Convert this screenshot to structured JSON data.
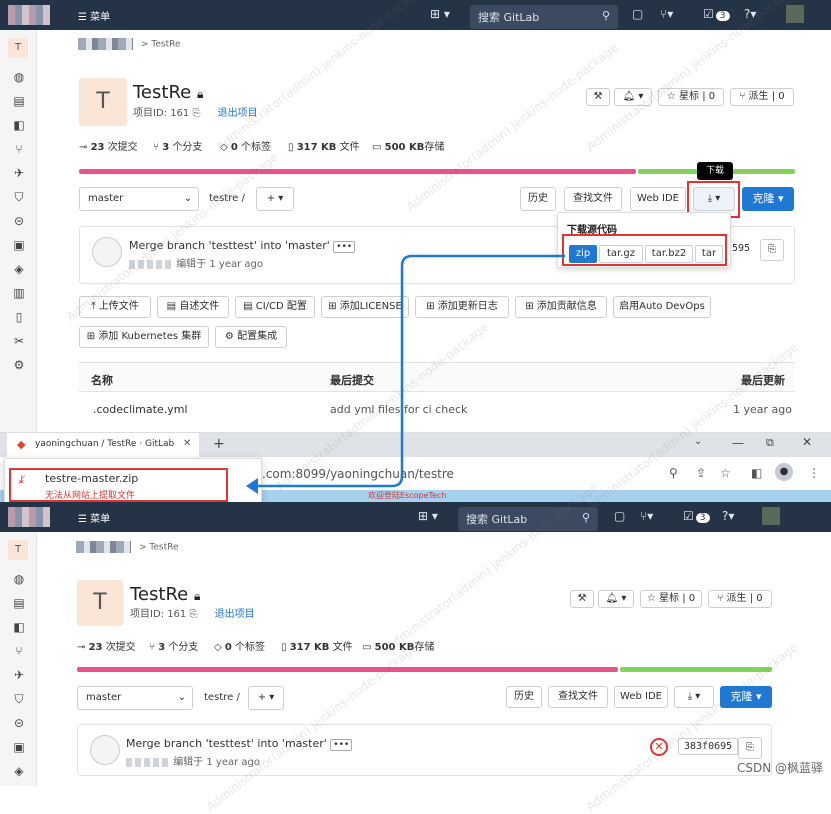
{
  "top": {
    "menu": "菜单",
    "search_placeholder": "搜索 GitLab",
    "todo_count": "3"
  },
  "sidebar": {
    "project_letter": "T"
  },
  "breadcrumb": {
    "project": "TestRe"
  },
  "project": {
    "avatar_letter": "T",
    "name": "TestRe",
    "id_label": "项目ID: 161",
    "leave": "退出项目",
    "star_label": "星标",
    "star_count": "0",
    "fork_label": "派生",
    "fork_count": "0"
  },
  "stats": {
    "commits_count": "23",
    "commits_label": "次提交",
    "branches_count": "3",
    "branches_label": "个分支",
    "tags_count": "0",
    "tags_label": "个标签",
    "files_size": "317 KB",
    "files_label": "文件",
    "storage_size": "500 KB",
    "storage_label": "存储"
  },
  "language_bar": {
    "pink_fraction": 0.78,
    "green_fraction": 0.22
  },
  "repo_nav": {
    "branch": "master",
    "path": "testre",
    "path_sep": "/",
    "history": "历史",
    "find_file": "查找文件",
    "web_ide": "Web IDE",
    "clone": "克隆"
  },
  "download_tooltip": "下载",
  "download_menu": {
    "title": "下载源代码",
    "options": [
      "zip",
      "tar.gz",
      "tar.bz2",
      "tar"
    ]
  },
  "commit": {
    "message": "Merge branch 'testtest' into 'master'",
    "meta": "编辑于 1 year ago",
    "sha_tail": "595",
    "sha": "383f0695"
  },
  "quick_actions": [
    "上传文件",
    "自述文件",
    "CI/CD 配置",
    "添加LICENSE",
    "添加更新日志",
    "添加贡献信息",
    "启用Auto DevOps",
    "添加 Kubernetes 集群",
    "配置集成"
  ],
  "files_table": {
    "col_name": "名称",
    "col_commit": "最后提交",
    "col_updated": "最后更新",
    "rows": [
      {
        "name": ".codeclimate.yml",
        "commit": "add yml files for ci check",
        "updated": "1 year ago"
      }
    ]
  },
  "browser": {
    "tab_title": "yaoningchuan / TestRe · GitLab",
    "new_tab": "+",
    "url_tail": ".com:8099/yaoningchuan/testre",
    "download_filename": "testre-master.zip",
    "download_error": "无法从网站上提取文件",
    "welcome": "欢迎登陆EscopeTech"
  },
  "watermark": "Administrator(admin) jenkins-node-package",
  "footer_credit": "CSDN @枫蓝驿",
  "colors": {
    "topbar": "#253347",
    "accent": "#1f78d1",
    "highlight": "#e03535",
    "lang_pink": "#e9528b",
    "lang_green": "#84d35a"
  }
}
